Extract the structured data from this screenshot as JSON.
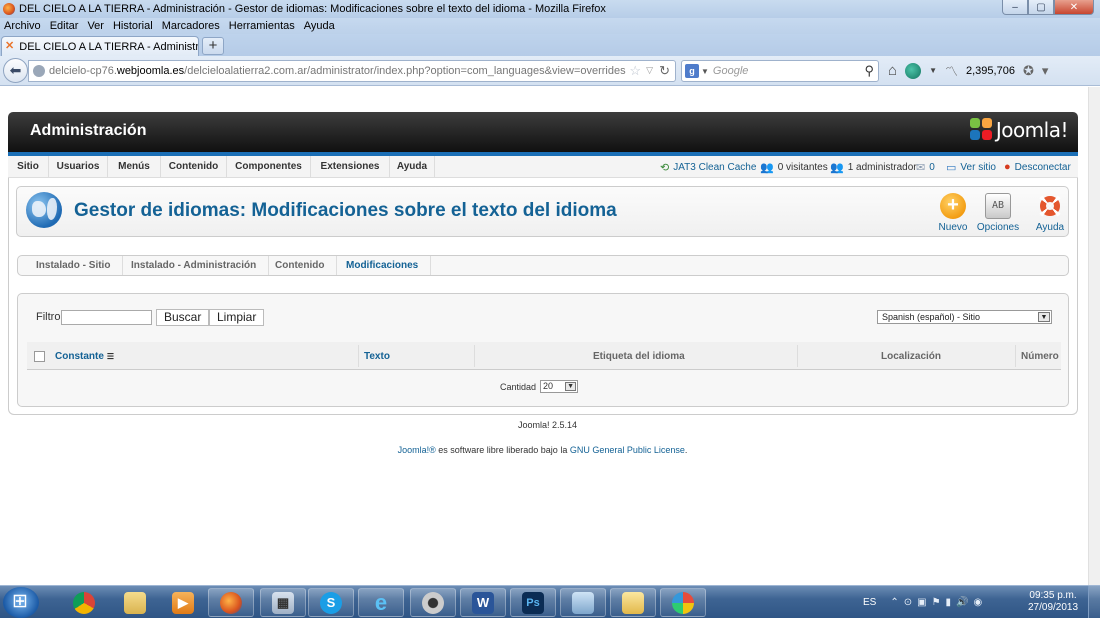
{
  "window": {
    "title": "DEL CIELO A LA TIERRA - Administración - Gestor de idiomas: Modificaciones sobre el texto del idioma - Mozilla Firefox",
    "controls": [
      "–",
      "▢",
      "✕"
    ]
  },
  "browser_menu": [
    "Archivo",
    "Editar",
    "Ver",
    "Historial",
    "Marcadores",
    "Herramientas",
    "Ayuda"
  ],
  "tab": {
    "title": "DEL CIELO A LA TIERRA - Administració...",
    "new_tab": "+"
  },
  "navbar": {
    "url_prefix": "delcielo-cp76.",
    "url_domain": "webjoomla.es",
    "url_rest": "/delcieloalatierra2.com.ar/administrator/index.php?option=com_languages&view=overrides",
    "search_placeholder": "Google",
    "rank": "2,395,706"
  },
  "admin": {
    "header_title": "Administración",
    "logo_text": "Joomla!",
    "menu": [
      "Sitio",
      "Usuarios",
      "Menús",
      "Contenido",
      "Componentes",
      "Extensiones",
      "Ayuda"
    ],
    "status": {
      "cache": "JAT3 Clean Cache",
      "visitors": "0 visitantes",
      "admins": "1 administrador",
      "messages": "0",
      "view_site": "Ver sitio",
      "logout": "Desconectar"
    },
    "page_title": "Gestor de idiomas: Modificaciones sobre el texto del idioma",
    "toolbar": {
      "new": "Nuevo",
      "options": "Opciones",
      "options_glyph": "AB",
      "help": "Ayuda"
    },
    "submenu": [
      "Instalado - Sitio",
      "Instalado - Administración",
      "Contenido",
      "Modificaciones"
    ],
    "submenu_active": "Modificaciones",
    "filter": {
      "label": "Filtro:",
      "value": "",
      "search_button": "Buscar",
      "clear_button": "Limpiar",
      "language_select": "Spanish (español) - Sitio"
    },
    "table": {
      "columns": [
        "Constante",
        "Texto",
        "Etiqueta del idioma",
        "Localización",
        "Número"
      ],
      "rows": []
    },
    "pagination": {
      "label": "Cantidad",
      "value": "20"
    },
    "footer": {
      "version": "Joomla! 2.5.14",
      "license_prefix": "Joomla!®",
      "license_middle": " es software libre liberado bajo la ",
      "license_link": "GNU General Public License",
      "license_end": "."
    }
  },
  "taskbar": {
    "apps": [
      "chrome",
      "explorer",
      "media",
      "firefox",
      "calculator",
      "skype",
      "ie",
      "webcam",
      "word",
      "photoshop",
      "app",
      "folder",
      "paint"
    ],
    "active_app": "firefox",
    "language": "ES",
    "time": "09:35 p.m.",
    "date": "27/09/2013"
  },
  "colors": {
    "accent": "#146295",
    "header_dark": "#101010",
    "stripe": "#1b6fb6"
  }
}
